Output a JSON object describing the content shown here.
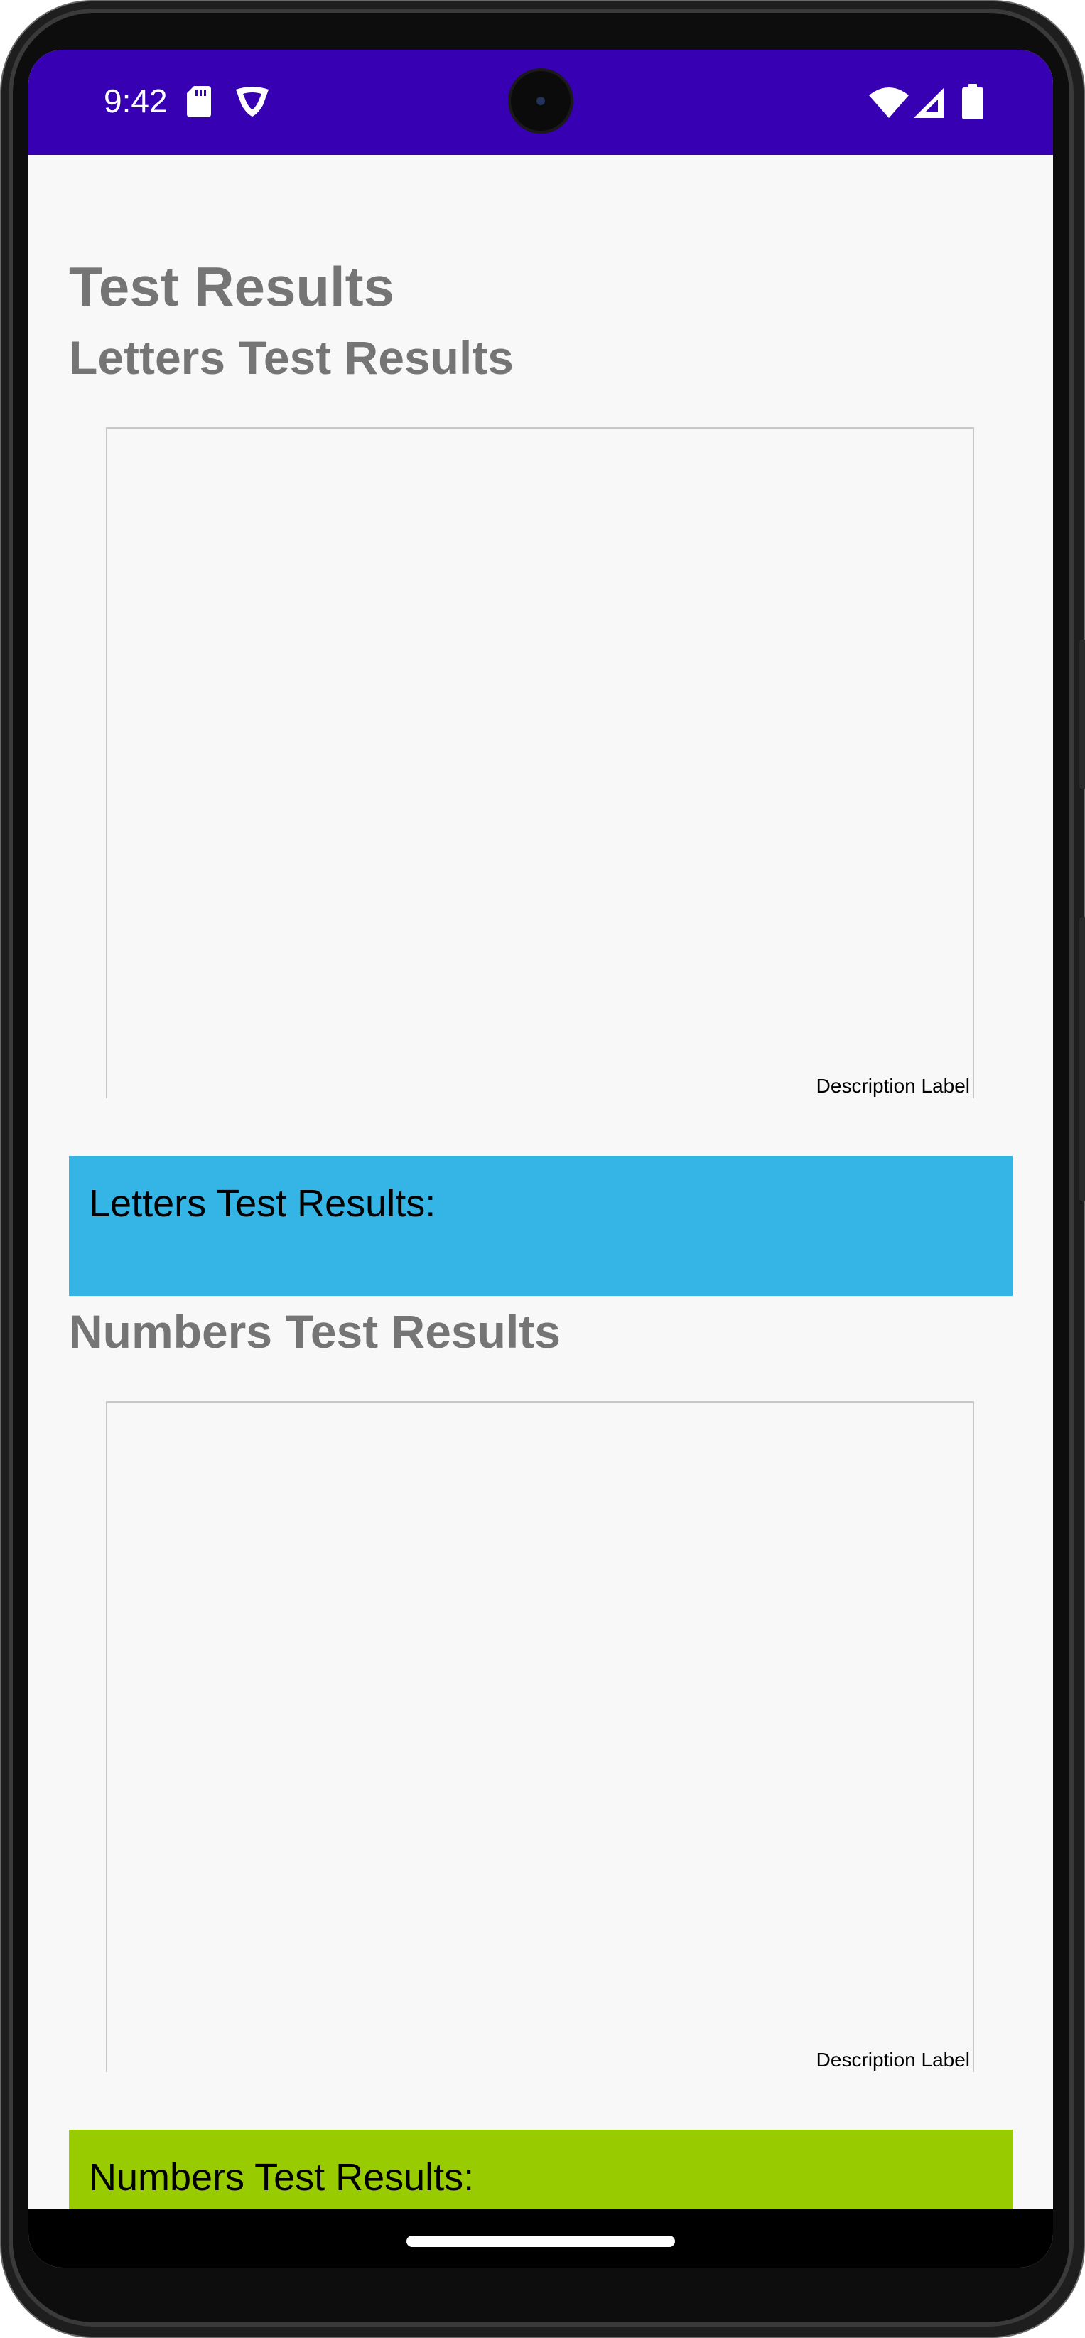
{
  "status_bar": {
    "time": "9:42",
    "background": "#3700b3",
    "left_icons": [
      "sd-card-icon",
      "vpn-shield-icon"
    ],
    "right_icons": [
      "wifi-icon",
      "cellular-signal-icon",
      "battery-icon"
    ]
  },
  "page": {
    "title": "Test Results",
    "background": "#f8f8f8"
  },
  "letters_section": {
    "title": "Letters Test Results",
    "chart_description": "Description Label",
    "result_label": "Letters Test Results:",
    "result_color": "#35b5e5"
  },
  "numbers_section": {
    "title": "Numbers Test Results",
    "chart_description": "Description Label",
    "result_label": "Numbers Test Results:",
    "result_color": "#99cc00"
  },
  "nav_bar": {
    "handle": "home-gesture-handle"
  }
}
